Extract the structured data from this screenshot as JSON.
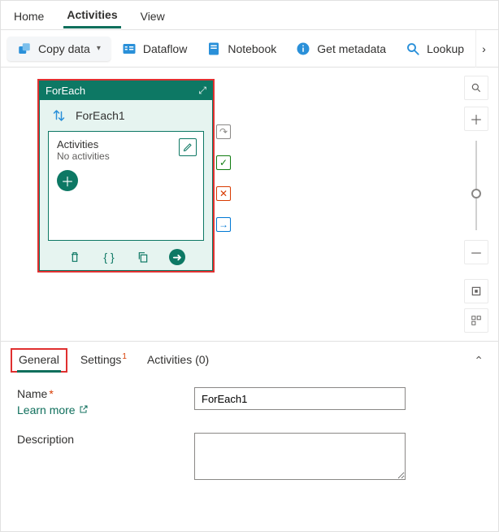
{
  "nav": {
    "home": "Home",
    "activities": "Activities",
    "view": "View"
  },
  "toolbar": {
    "copy_data": "Copy data",
    "dataflow": "Dataflow",
    "notebook": "Notebook",
    "get_metadata": "Get metadata",
    "lookup": "Lookup"
  },
  "node": {
    "type": "ForEach",
    "name": "ForEach1",
    "activities_label": "Activities",
    "no_activities": "No activities"
  },
  "details": {
    "tabs": {
      "general": "General",
      "settings": "Settings",
      "activities": "Activities (0)",
      "settings_badge": "1"
    },
    "name_label": "Name",
    "learn_more": "Learn more",
    "description_label": "Description",
    "name_value": "ForEach1",
    "description_value": ""
  }
}
